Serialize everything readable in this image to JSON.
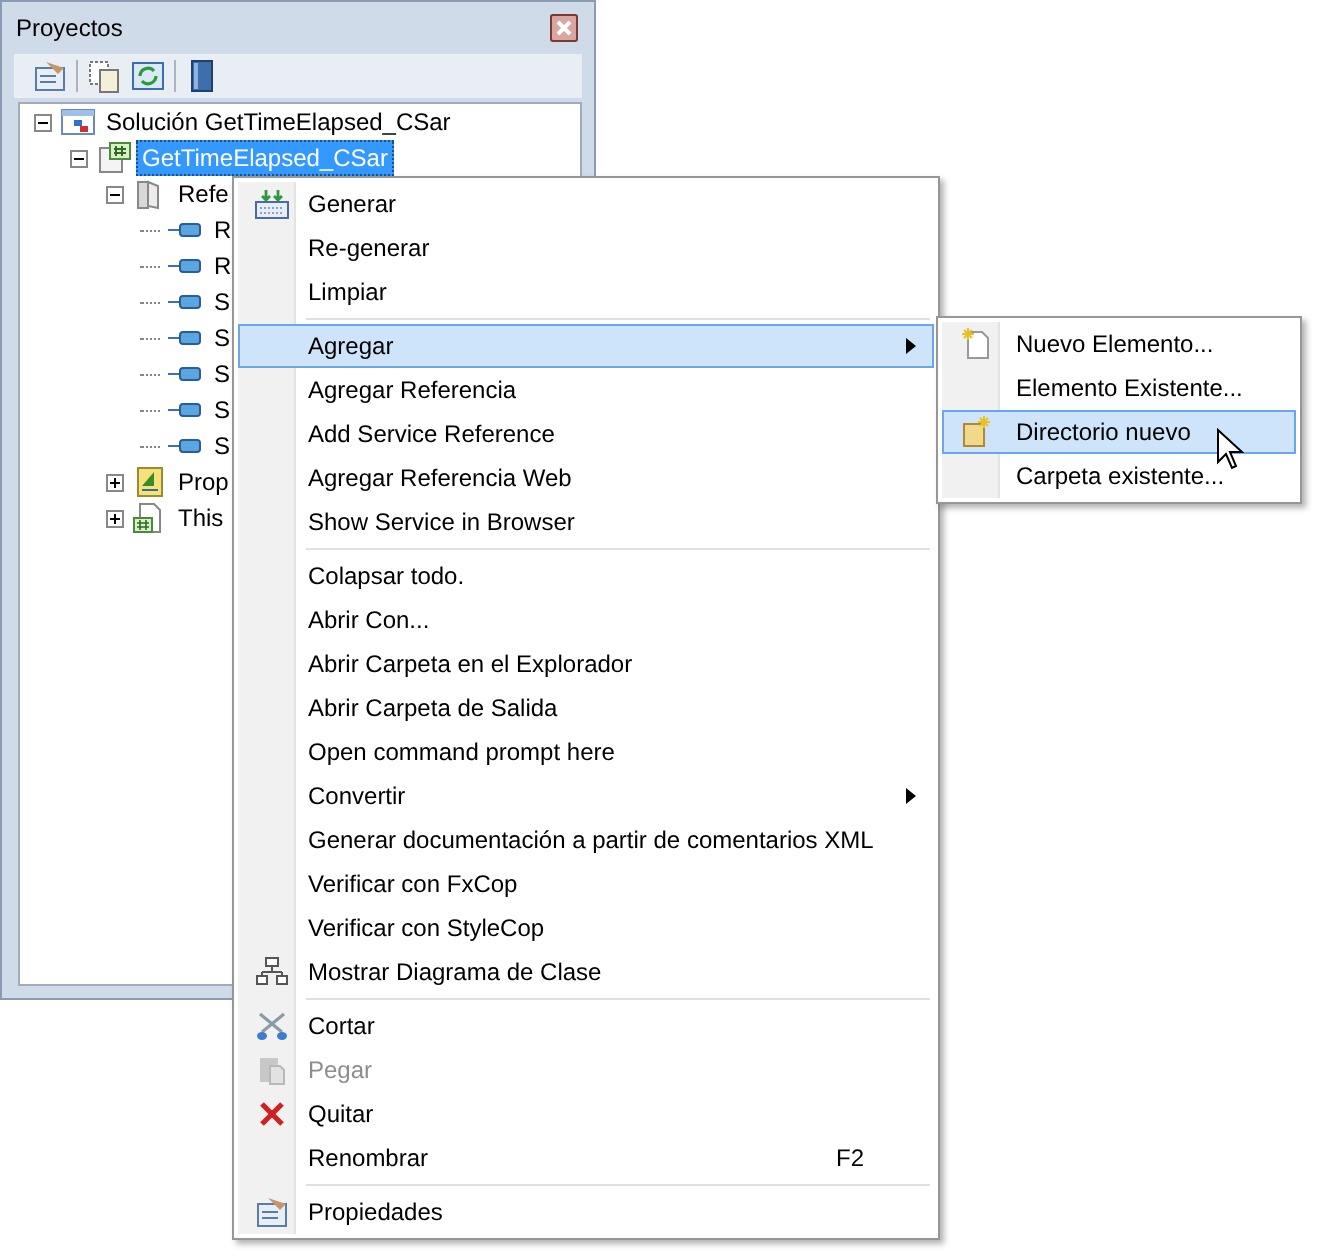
{
  "panel": {
    "title": "Proyectos"
  },
  "tree": [
    {
      "label": "Solución GetTimeElapsed_CSar",
      "kind": "solution",
      "expanded": true,
      "selected": false,
      "children": [
        {
          "label": "GetTimeElapsed_CSar",
          "kind": "project",
          "expanded": true,
          "selected": true,
          "children": [
            {
              "label": "Refe",
              "kind": "references",
              "expanded": true,
              "selected": false,
              "children": [
                {
                  "label": "R",
                  "kind": "reference",
                  "selected": false
                },
                {
                  "label": "R",
                  "kind": "reference",
                  "selected": false
                },
                {
                  "label": "S",
                  "kind": "reference",
                  "selected": false
                },
                {
                  "label": "S",
                  "kind": "reference",
                  "selected": false
                },
                {
                  "label": "S",
                  "kind": "reference",
                  "selected": false
                },
                {
                  "label": "S",
                  "kind": "reference",
                  "selected": false
                },
                {
                  "label": "S",
                  "kind": "reference",
                  "selected": false
                }
              ]
            },
            {
              "label": "Prop",
              "kind": "properties",
              "expanded": false,
              "selected": false
            },
            {
              "label": "This",
              "kind": "file",
              "expanded": false,
              "selected": false
            }
          ]
        }
      ]
    }
  ],
  "context_menu": [
    {
      "kind": "item",
      "label": "Generar",
      "selected": false,
      "disabled": false
    },
    {
      "kind": "item",
      "label": "Re-generar",
      "selected": false,
      "disabled": false
    },
    {
      "kind": "item",
      "label": "Limpiar",
      "selected": false,
      "disabled": false
    },
    {
      "kind": "separator"
    },
    {
      "kind": "item",
      "label": "Agregar",
      "submenu": true,
      "selected": true,
      "disabled": false
    },
    {
      "kind": "item",
      "label": "Agregar Referencia",
      "selected": false,
      "disabled": false
    },
    {
      "kind": "item",
      "label": "Add Service Reference",
      "selected": false,
      "disabled": false
    },
    {
      "kind": "item",
      "label": "Agregar Referencia Web",
      "selected": false,
      "disabled": false
    },
    {
      "kind": "item",
      "label": "Show Service in Browser",
      "selected": false,
      "disabled": false
    },
    {
      "kind": "separator"
    },
    {
      "kind": "item",
      "label": "Colapsar todo.",
      "selected": false,
      "disabled": false
    },
    {
      "kind": "item",
      "label": "Abrir Con...",
      "selected": false,
      "disabled": false
    },
    {
      "kind": "item",
      "label": "Abrir Carpeta en el Explorador",
      "selected": false,
      "disabled": false
    },
    {
      "kind": "item",
      "label": "Abrir Carpeta de Salida",
      "selected": false,
      "disabled": false
    },
    {
      "kind": "item",
      "label": "Open command prompt here",
      "selected": false,
      "disabled": false
    },
    {
      "kind": "item",
      "label": "Convertir",
      "submenu": true,
      "selected": false,
      "disabled": false
    },
    {
      "kind": "item",
      "label": "Generar documentación a partir de comentarios XML",
      "selected": false,
      "disabled": false
    },
    {
      "kind": "item",
      "label": "Verificar con FxCop",
      "selected": false,
      "disabled": false
    },
    {
      "kind": "item",
      "label": "Verificar con StyleCop",
      "selected": false,
      "disabled": false
    },
    {
      "kind": "item",
      "label": "Mostrar Diagrama de Clase",
      "selected": false,
      "disabled": false
    },
    {
      "kind": "separator"
    },
    {
      "kind": "item",
      "label": "Cortar",
      "selected": false,
      "disabled": false
    },
    {
      "kind": "item",
      "label": "Pegar",
      "selected": false,
      "disabled": true
    },
    {
      "kind": "item",
      "label": "Quitar",
      "selected": false,
      "disabled": false
    },
    {
      "kind": "item",
      "label": "Renombrar",
      "shortcut": "F2",
      "selected": false,
      "disabled": false
    },
    {
      "kind": "separator"
    },
    {
      "kind": "item",
      "label": "Propiedades",
      "selected": false,
      "disabled": false
    }
  ],
  "submenu": [
    {
      "label": "Nuevo Elemento...",
      "selected": false
    },
    {
      "label": "Elemento Existente...",
      "selected": false
    },
    {
      "label": "Directorio nuevo",
      "selected": true
    },
    {
      "label": "Carpeta existente...",
      "selected": false
    }
  ]
}
